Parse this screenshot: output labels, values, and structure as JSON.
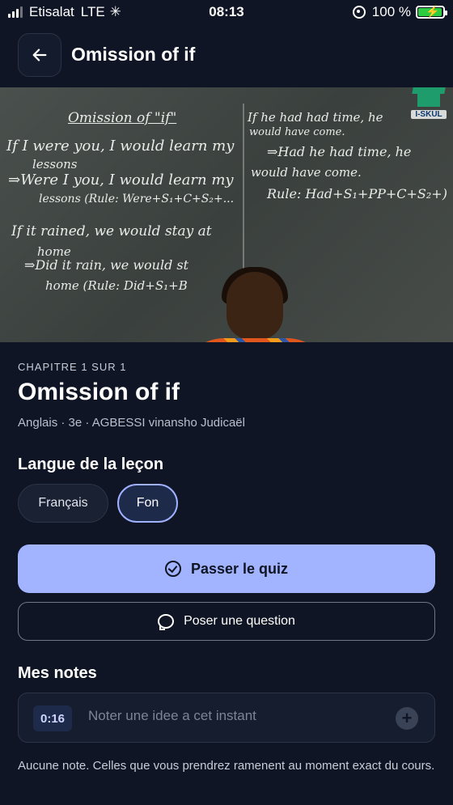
{
  "status_bar": {
    "carrier": "Etisalat",
    "network": "LTE",
    "loading_icon": "✳",
    "time": "08:13",
    "battery": "100 %",
    "battery_level": 1.0
  },
  "header": {
    "back_icon": "arrow-left",
    "title": "Omission of if"
  },
  "video": {
    "logo_text": "I-SKUL",
    "board_lines": [
      "Omission of \"if\"",
      "If I were you, I would learn my",
      "lessons",
      "⇒Were I you, I would learn my",
      "lessons (Rule: Were+S₁+C+S₂+...",
      "If it rained, we would stay at",
      "home",
      "⇒Did it rain, we would st",
      "home (Rule: Did+S₁+B",
      "If he had had time, he",
      "would have come.",
      "⇒Had he had time, he",
      "would have come.",
      "Rule: Had+S₁+PP+C+S₂+)"
    ]
  },
  "lesson": {
    "chapter_label": "CHAPITRE 1 SUR 1",
    "title": "Omission of if",
    "meta": "Anglais · 3e · AGBESSI vinansho Judicaël"
  },
  "language": {
    "heading": "Langue de la leçon",
    "options": [
      "Français",
      "Fon"
    ],
    "selected": "Fon"
  },
  "actions": {
    "quiz_label": "Passer le quiz",
    "ask_label": "Poser une question"
  },
  "notes": {
    "heading": "Mes notes",
    "timestamp": "0:16",
    "placeholder": "Noter une idee a cet instant",
    "add_symbol": "+",
    "empty_text": "Aucune note. Celles que vous prendrez ramenent au moment exact du cours."
  },
  "colors": {
    "background": "#0f1524",
    "primary_button": "#a2b4ff",
    "chip_selected_border": "#9fb1ff"
  }
}
